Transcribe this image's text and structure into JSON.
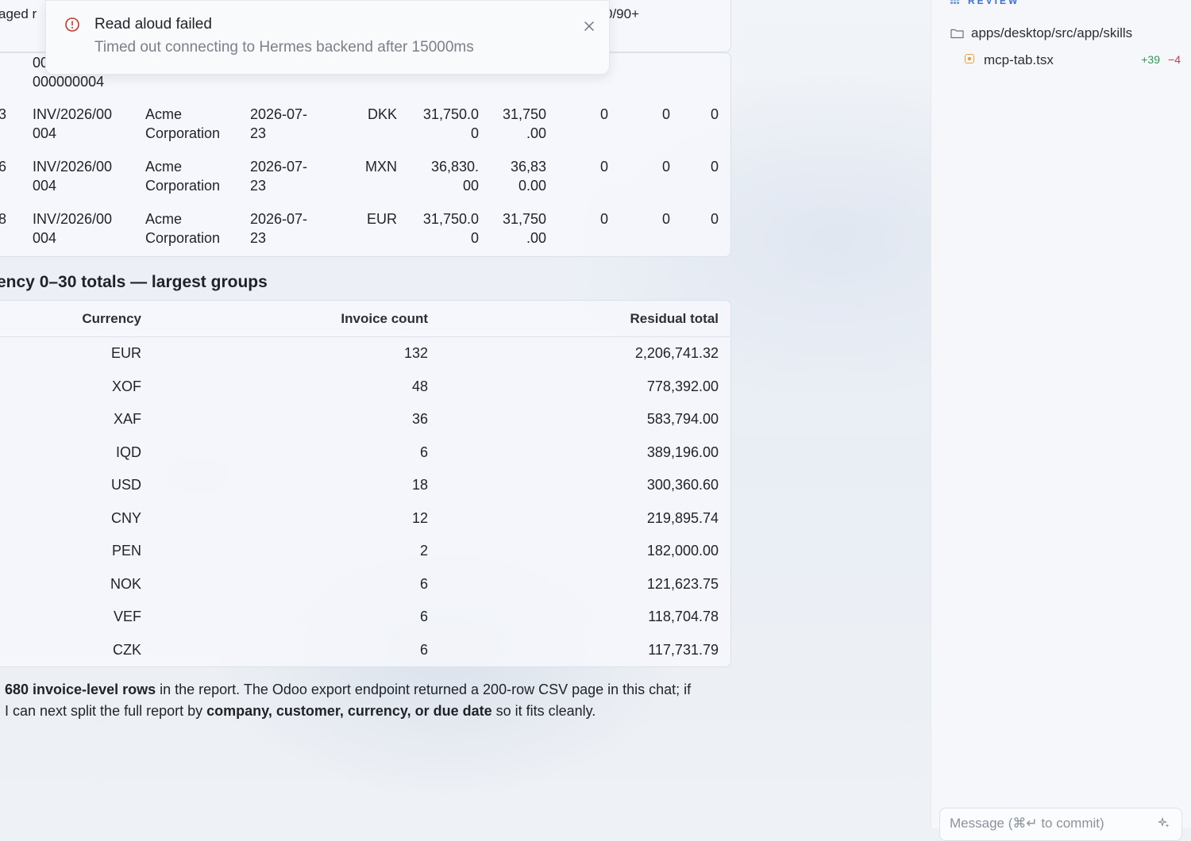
{
  "toast": {
    "title": "Read aloud failed",
    "message": "Timed out connecting to Hermes backend after 15000ms"
  },
  "top_peek": {
    "left_text": "aged r",
    "right_text": "0/90+",
    "row_fragment_1": "00",
    "row_fragment_2": "000000004"
  },
  "invoice_rows": [
    {
      "id_tail": "3",
      "number_l1": "INV/2026/00",
      "number_l2": "004",
      "partner_l1": "Acme",
      "partner_l2": "Corporation",
      "date_l1": "2026-07-",
      "date_l2": "23",
      "currency": "DKK",
      "amount_l1": "31,750.0",
      "amount_l2": "0",
      "residual_l1": "31,750",
      "residual_l2": ".00",
      "b1": "0",
      "b2": "0",
      "b3": "0"
    },
    {
      "id_tail": "6",
      "number_l1": "INV/2026/00",
      "number_l2": "004",
      "partner_l1": "Acme",
      "partner_l2": "Corporation",
      "date_l1": "2026-07-",
      "date_l2": "23",
      "currency": "MXN",
      "amount_l1": "36,830.",
      "amount_l2": "00",
      "residual_l1": "36,83",
      "residual_l2": "0.00",
      "b1": "0",
      "b2": "0",
      "b3": "0"
    },
    {
      "id_tail": "8",
      "number_l1": "INV/2026/00",
      "number_l2": "004",
      "partner_l1": "Acme",
      "partner_l2": "Corporation",
      "date_l1": "2026-07-",
      "date_l2": "23",
      "currency": "EUR",
      "amount_l1": "31,750.0",
      "amount_l2": "0",
      "residual_l1": "31,750",
      "residual_l2": ".00",
      "b1": "0",
      "b2": "0",
      "b3": "0"
    }
  ],
  "currency_section": {
    "heading": "ency 0–30 totals — largest groups",
    "headers": {
      "currency": "Currency",
      "count": "Invoice count",
      "residual": "Residual total"
    },
    "rows": [
      {
        "currency": "EUR",
        "count": "132",
        "residual": "2,206,741.32"
      },
      {
        "currency": "XOF",
        "count": "48",
        "residual": "778,392.00"
      },
      {
        "currency": "XAF",
        "count": "36",
        "residual": "583,794.00"
      },
      {
        "currency": "IQD",
        "count": "6",
        "residual": "389,196.00"
      },
      {
        "currency": "USD",
        "count": "18",
        "residual": "300,360.60"
      },
      {
        "currency": "CNY",
        "count": "12",
        "residual": "219,895.74"
      },
      {
        "currency": "PEN",
        "count": "2",
        "residual": "182,000.00"
      },
      {
        "currency": "NOK",
        "count": "6",
        "residual": "121,623.75"
      },
      {
        "currency": "VEF",
        "count": "6",
        "residual": "118,704.78"
      },
      {
        "currency": "CZK",
        "count": "6",
        "residual": "117,731.79"
      }
    ]
  },
  "summary": {
    "bold1": "680 invoice-level rows",
    "text1": " in the report. The Odoo export endpoint returned a 200-row CSV page in this chat; if",
    "text2": "I can next split the full report by ",
    "bold2": "company, customer, currency, or due date",
    "text3": " so it fits cleanly."
  },
  "sidebar": {
    "review_label": "REVIEW",
    "folder_path": "apps/desktop/src/app/skills",
    "file": {
      "name": "mcp-tab.tsx",
      "additions": "+39",
      "deletions": "−4"
    },
    "message_placeholder": "Message (⌘↵ to commit)"
  },
  "colors": {
    "accent": "#3b6fd6",
    "error": "#c0392b",
    "added": "#2e9b55",
    "removed": "#d1393f",
    "modified": "#e9a23b"
  }
}
